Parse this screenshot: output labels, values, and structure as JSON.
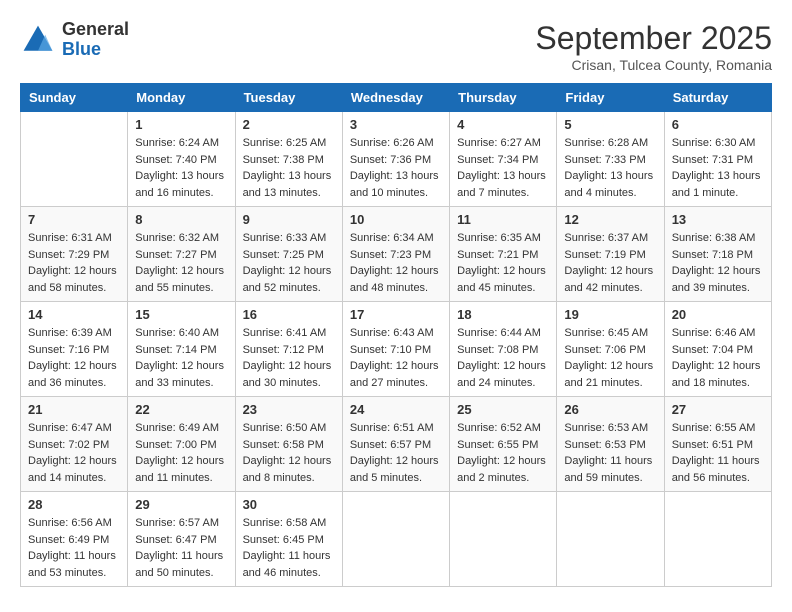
{
  "header": {
    "logo": {
      "general": "General",
      "blue": "Blue"
    },
    "month": "September 2025",
    "location": "Crisan, Tulcea County, Romania"
  },
  "days_of_week": [
    "Sunday",
    "Monday",
    "Tuesday",
    "Wednesday",
    "Thursday",
    "Friday",
    "Saturday"
  ],
  "weeks": [
    [
      {
        "day": "",
        "info": ""
      },
      {
        "day": "1",
        "info": "Sunrise: 6:24 AM\nSunset: 7:40 PM\nDaylight: 13 hours\nand 16 minutes."
      },
      {
        "day": "2",
        "info": "Sunrise: 6:25 AM\nSunset: 7:38 PM\nDaylight: 13 hours\nand 13 minutes."
      },
      {
        "day": "3",
        "info": "Sunrise: 6:26 AM\nSunset: 7:36 PM\nDaylight: 13 hours\nand 10 minutes."
      },
      {
        "day": "4",
        "info": "Sunrise: 6:27 AM\nSunset: 7:34 PM\nDaylight: 13 hours\nand 7 minutes."
      },
      {
        "day": "5",
        "info": "Sunrise: 6:28 AM\nSunset: 7:33 PM\nDaylight: 13 hours\nand 4 minutes."
      },
      {
        "day": "6",
        "info": "Sunrise: 6:30 AM\nSunset: 7:31 PM\nDaylight: 13 hours\nand 1 minute."
      }
    ],
    [
      {
        "day": "7",
        "info": "Sunrise: 6:31 AM\nSunset: 7:29 PM\nDaylight: 12 hours\nand 58 minutes."
      },
      {
        "day": "8",
        "info": "Sunrise: 6:32 AM\nSunset: 7:27 PM\nDaylight: 12 hours\nand 55 minutes."
      },
      {
        "day": "9",
        "info": "Sunrise: 6:33 AM\nSunset: 7:25 PM\nDaylight: 12 hours\nand 52 minutes."
      },
      {
        "day": "10",
        "info": "Sunrise: 6:34 AM\nSunset: 7:23 PM\nDaylight: 12 hours\nand 48 minutes."
      },
      {
        "day": "11",
        "info": "Sunrise: 6:35 AM\nSunset: 7:21 PM\nDaylight: 12 hours\nand 45 minutes."
      },
      {
        "day": "12",
        "info": "Sunrise: 6:37 AM\nSunset: 7:19 PM\nDaylight: 12 hours\nand 42 minutes."
      },
      {
        "day": "13",
        "info": "Sunrise: 6:38 AM\nSunset: 7:18 PM\nDaylight: 12 hours\nand 39 minutes."
      }
    ],
    [
      {
        "day": "14",
        "info": "Sunrise: 6:39 AM\nSunset: 7:16 PM\nDaylight: 12 hours\nand 36 minutes."
      },
      {
        "day": "15",
        "info": "Sunrise: 6:40 AM\nSunset: 7:14 PM\nDaylight: 12 hours\nand 33 minutes."
      },
      {
        "day": "16",
        "info": "Sunrise: 6:41 AM\nSunset: 7:12 PM\nDaylight: 12 hours\nand 30 minutes."
      },
      {
        "day": "17",
        "info": "Sunrise: 6:43 AM\nSunset: 7:10 PM\nDaylight: 12 hours\nand 27 minutes."
      },
      {
        "day": "18",
        "info": "Sunrise: 6:44 AM\nSunset: 7:08 PM\nDaylight: 12 hours\nand 24 minutes."
      },
      {
        "day": "19",
        "info": "Sunrise: 6:45 AM\nSunset: 7:06 PM\nDaylight: 12 hours\nand 21 minutes."
      },
      {
        "day": "20",
        "info": "Sunrise: 6:46 AM\nSunset: 7:04 PM\nDaylight: 12 hours\nand 18 minutes."
      }
    ],
    [
      {
        "day": "21",
        "info": "Sunrise: 6:47 AM\nSunset: 7:02 PM\nDaylight: 12 hours\nand 14 minutes."
      },
      {
        "day": "22",
        "info": "Sunrise: 6:49 AM\nSunset: 7:00 PM\nDaylight: 12 hours\nand 11 minutes."
      },
      {
        "day": "23",
        "info": "Sunrise: 6:50 AM\nSunset: 6:58 PM\nDaylight: 12 hours\nand 8 minutes."
      },
      {
        "day": "24",
        "info": "Sunrise: 6:51 AM\nSunset: 6:57 PM\nDaylight: 12 hours\nand 5 minutes."
      },
      {
        "day": "25",
        "info": "Sunrise: 6:52 AM\nSunset: 6:55 PM\nDaylight: 12 hours\nand 2 minutes."
      },
      {
        "day": "26",
        "info": "Sunrise: 6:53 AM\nSunset: 6:53 PM\nDaylight: 11 hours\nand 59 minutes."
      },
      {
        "day": "27",
        "info": "Sunrise: 6:55 AM\nSunset: 6:51 PM\nDaylight: 11 hours\nand 56 minutes."
      }
    ],
    [
      {
        "day": "28",
        "info": "Sunrise: 6:56 AM\nSunset: 6:49 PM\nDaylight: 11 hours\nand 53 minutes."
      },
      {
        "day": "29",
        "info": "Sunrise: 6:57 AM\nSunset: 6:47 PM\nDaylight: 11 hours\nand 50 minutes."
      },
      {
        "day": "30",
        "info": "Sunrise: 6:58 AM\nSunset: 6:45 PM\nDaylight: 11 hours\nand 46 minutes."
      },
      {
        "day": "",
        "info": ""
      },
      {
        "day": "",
        "info": ""
      },
      {
        "day": "",
        "info": ""
      },
      {
        "day": "",
        "info": ""
      }
    ]
  ]
}
